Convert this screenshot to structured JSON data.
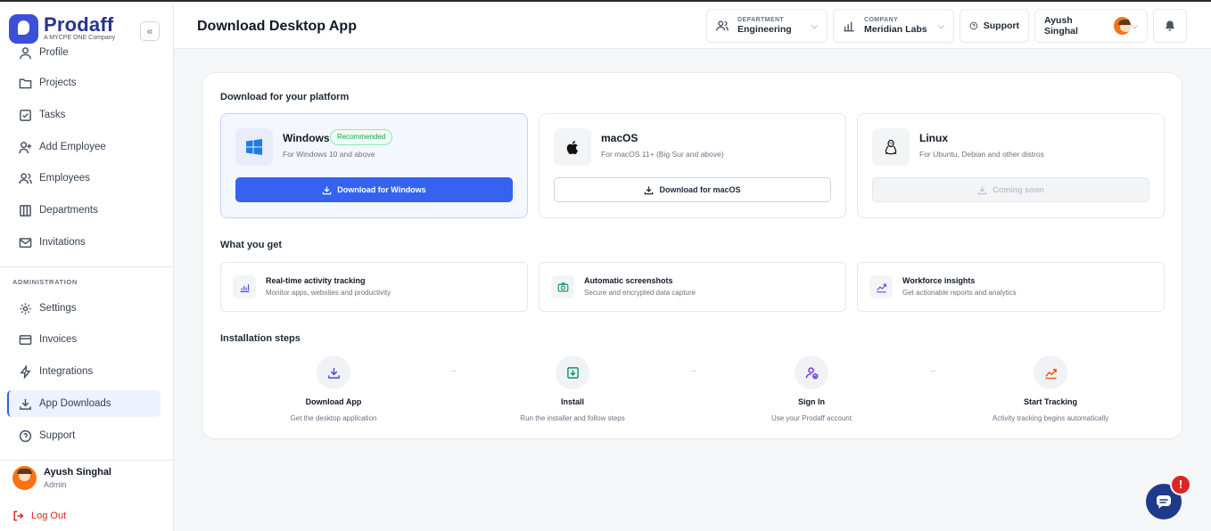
{
  "brand": {
    "name": "Prodaff",
    "tagline": "A MYCPE ONE Company",
    "color": "#3b4fd8"
  },
  "sidebar": {
    "collapse_label": "«",
    "items": [
      {
        "label": "Profile",
        "icon": "user-icon"
      },
      {
        "label": "Projects",
        "icon": "folder-icon"
      },
      {
        "label": "Tasks",
        "icon": "checkbox-icon"
      },
      {
        "label": "Add Employee",
        "icon": "user-plus-icon"
      },
      {
        "label": "Employees",
        "icon": "users-icon"
      },
      {
        "label": "Departments",
        "icon": "building-icon"
      },
      {
        "label": "Invitations",
        "icon": "mail-icon"
      }
    ],
    "admin_section_label": "ADMINISTRATION",
    "admin_items": [
      {
        "label": "Settings",
        "icon": "gear-icon"
      },
      {
        "label": "Invoices",
        "icon": "card-icon"
      },
      {
        "label": "Integrations",
        "icon": "bolt-icon"
      },
      {
        "label": "App Downloads",
        "icon": "download-icon",
        "active": true
      },
      {
        "label": "Support",
        "icon": "help-icon"
      }
    ],
    "user": {
      "name": "Ayush Singhal",
      "role": "Admin"
    },
    "logout_label": "Log Out"
  },
  "topbar": {
    "title": "Download Desktop App",
    "department": {
      "label": "DEPARTMENT",
      "value": "Engineering"
    },
    "company": {
      "label": "COMPANY",
      "value": "Meridian Labs"
    },
    "support_label": "Support",
    "user_name": "Ayush Singhal"
  },
  "platforms": {
    "title": "Download for your platform",
    "items": [
      {
        "name": "Windows",
        "badge": "Recommended",
        "desc": "For Windows 10 and above",
        "button": "Download for Windows"
      },
      {
        "name": "macOS",
        "desc": "For macOS 11+ (Big Sur and above)",
        "button": "Download for macOS"
      },
      {
        "name": "Linux",
        "desc": "For Ubuntu, Debian and other distros",
        "button": "Coming soon"
      }
    ]
  },
  "features": {
    "title": "What you get",
    "items": [
      {
        "title": "Real-time activity tracking",
        "desc": "Monitor apps, websites and productivity"
      },
      {
        "title": "Automatic screenshots",
        "desc": "Secure and encrypted data capture"
      },
      {
        "title": "Workforce insights",
        "desc": "Get actionable reports and analytics"
      }
    ]
  },
  "steps": {
    "title": "Installation steps",
    "items": [
      {
        "title": "Download App",
        "desc": "Get the desktop application"
      },
      {
        "title": "Install",
        "desc": "Run the installer and follow steps"
      },
      {
        "title": "Sign In",
        "desc": "Use your Prodaff account"
      },
      {
        "title": "Start Tracking",
        "desc": "Activity tracking begins automatically"
      }
    ],
    "arrow": "→"
  },
  "chat": {
    "alert": "!"
  }
}
